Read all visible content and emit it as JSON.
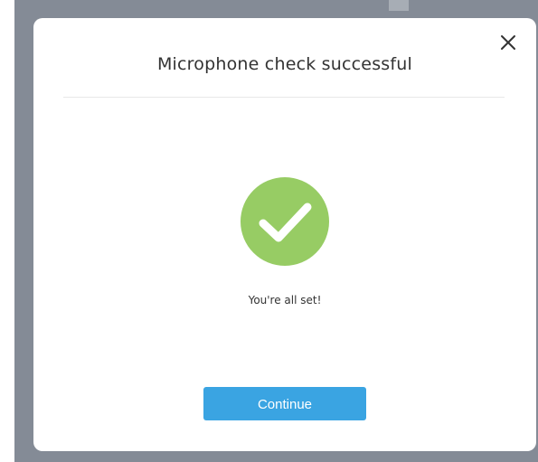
{
  "dialog": {
    "title": "Microphone check successful",
    "status_text": "You're all set!",
    "continue_label": "Continue",
    "close_icon": "close-icon",
    "success_icon": "check-circle-icon"
  },
  "colors": {
    "backdrop": "#848b96",
    "success": "#97cc64",
    "button": "#3aa4e2"
  }
}
